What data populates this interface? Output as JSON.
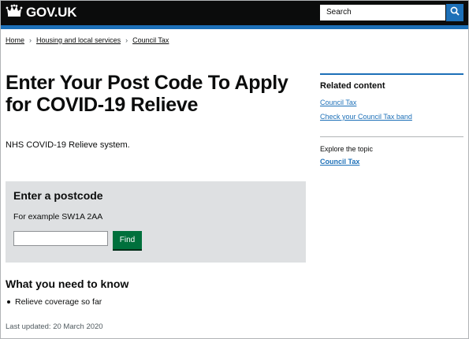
{
  "header": {
    "logo_text": "GOV.UK",
    "logo_icon": "crown-icon",
    "search_placeholder": "Search",
    "search_icon": "search-icon"
  },
  "breadcrumb": {
    "items": [
      "Home",
      "Housing and local services",
      "Council Tax"
    ],
    "separator": "›"
  },
  "main": {
    "title": "Enter Your Post Code To Apply for COVID-19 Relieve",
    "lede": "NHS COVID-19 Relieve system.",
    "postcode": {
      "heading": "Enter a postcode",
      "hint": "For example SW1A 2AA",
      "input_value": "",
      "find_label": "Find"
    },
    "need_to_know": {
      "heading": "What you need to know",
      "items": [
        "Relieve coverage so far"
      ]
    },
    "last_updated": "Last updated: 20 March 2020"
  },
  "sidebar": {
    "heading": "Related content",
    "links": [
      "Council Tax",
      "Check your Council Tax band"
    ],
    "explore_label": "Explore the topic",
    "explore_link": "Council Tax"
  },
  "colors": {
    "header_bg": "#0b0c0c",
    "brand_blue": "#1d70b8",
    "button_green": "#00703c",
    "panel_grey": "#dee0e2"
  }
}
